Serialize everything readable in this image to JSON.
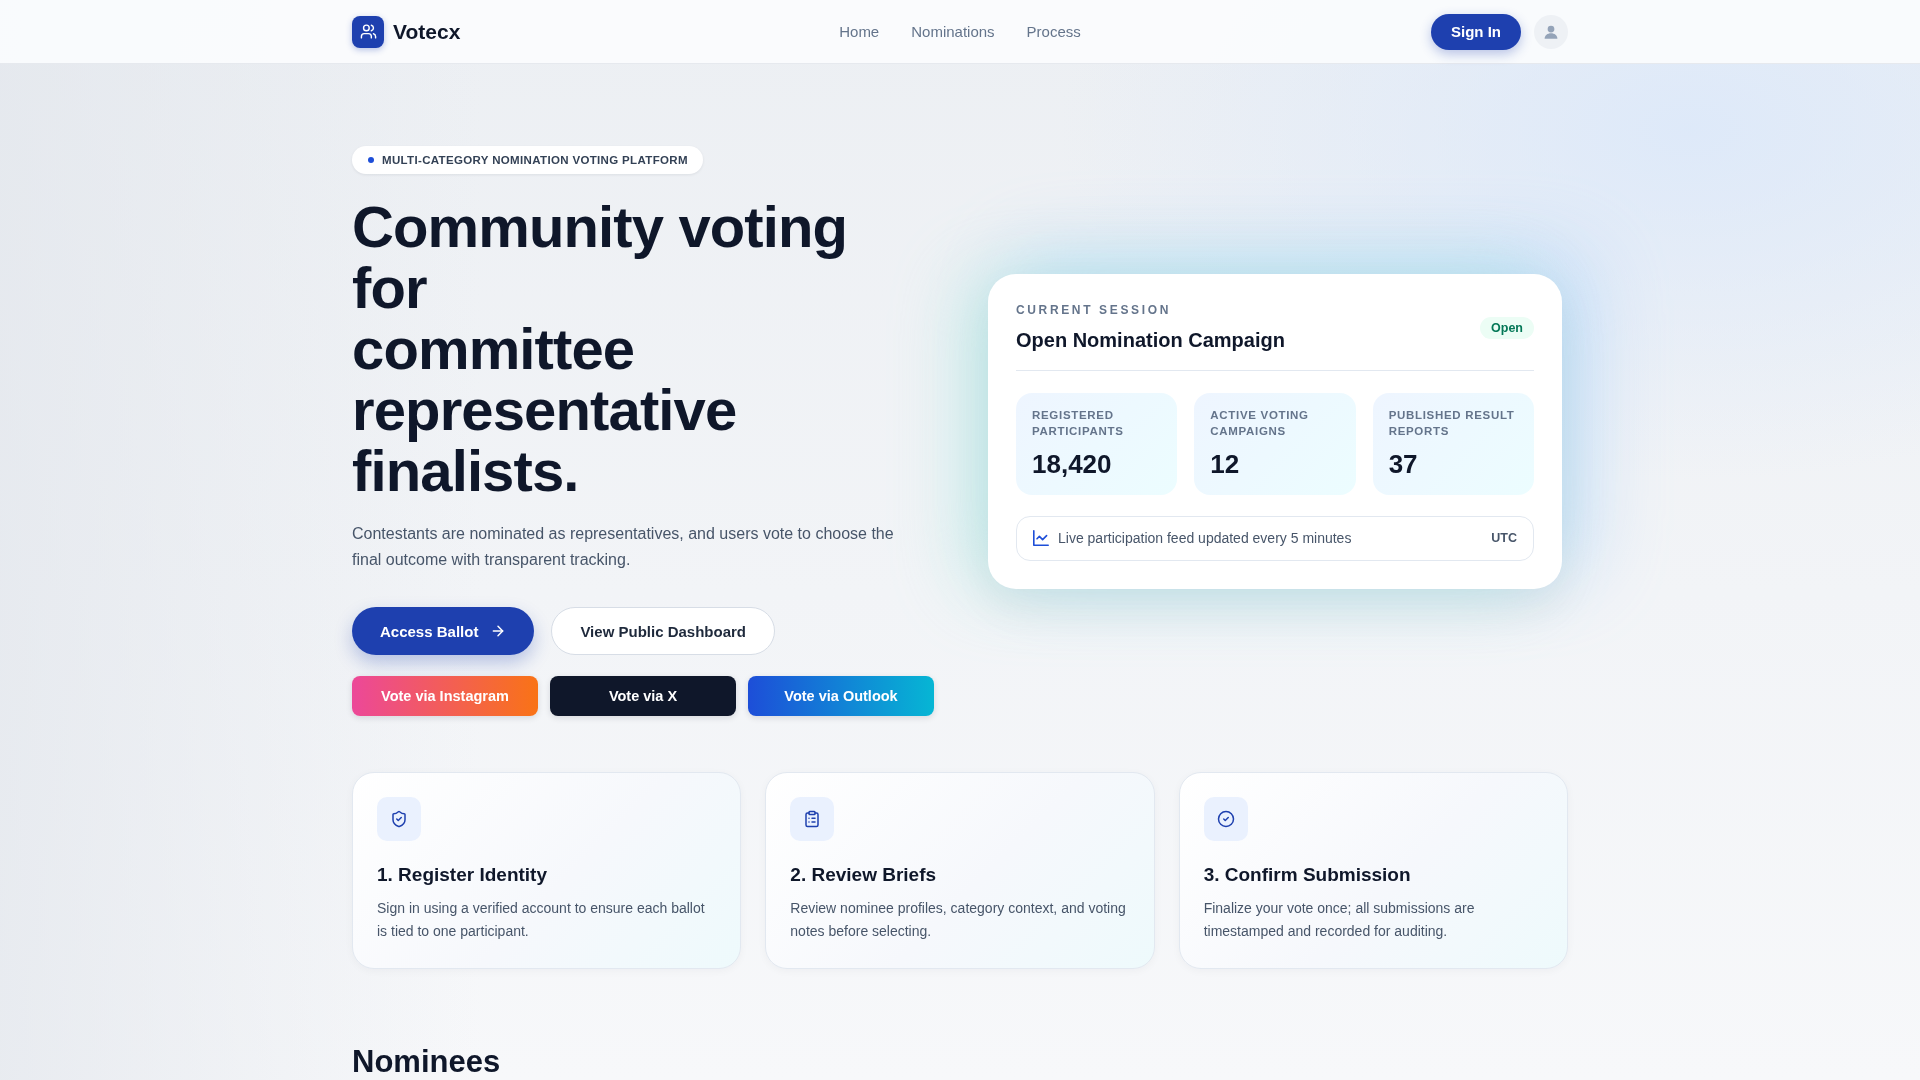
{
  "header": {
    "logo": "Votecx",
    "nav": [
      {
        "label": "Home"
      },
      {
        "label": "Nominations"
      },
      {
        "label": "Process"
      }
    ],
    "sign_in": "Sign In"
  },
  "hero": {
    "tagline": "MULTI-CATEGORY NOMINATION VOTING PLATFORM",
    "heading_lines": [
      "Community voting for",
      "committee representative finalists."
    ],
    "description": "Contestants are nominated as representatives, and users vote to choose the final outcome with transparent tracking.",
    "actions": [
      {
        "label": "Access Ballot",
        "kind": "primary"
      },
      {
        "label": "View Public Dashboard",
        "kind": "secondary"
      }
    ],
    "vote_buttons": [
      {
        "label": "Vote via Instagram",
        "kind": "instagram"
      },
      {
        "label": "Vote via X",
        "kind": "x"
      },
      {
        "label": "Vote via Outlook",
        "kind": "outlook"
      }
    ]
  },
  "session_card": {
    "eyebrow": "CURRENT SESSION",
    "title": "Open Nomination Campaign",
    "status": "Open",
    "stats": [
      {
        "label": "REGISTERED PARTICIPANTS",
        "value": "18,420"
      },
      {
        "label": "ACTIVE VOTING CAMPAIGNS",
        "value": "12"
      },
      {
        "label": "PUBLISHED RESULT REPORTS",
        "value": "37"
      }
    ],
    "feed": {
      "text": "Live participation feed updated every 5 minutes",
      "timezone": "UTC"
    }
  },
  "steps": [
    {
      "title": "1. Register Identity",
      "description": "Sign in using a verified account to ensure each ballot is tied to one participant."
    },
    {
      "title": "2. Review Briefs",
      "description": "Review nominee profiles, category context, and voting notes before selecting."
    },
    {
      "title": "3. Confirm Submission",
      "description": "Finalize your vote once; all submissions are timestamped and recorded for auditing."
    }
  ],
  "nominees": {
    "heading": "Nominees"
  }
}
